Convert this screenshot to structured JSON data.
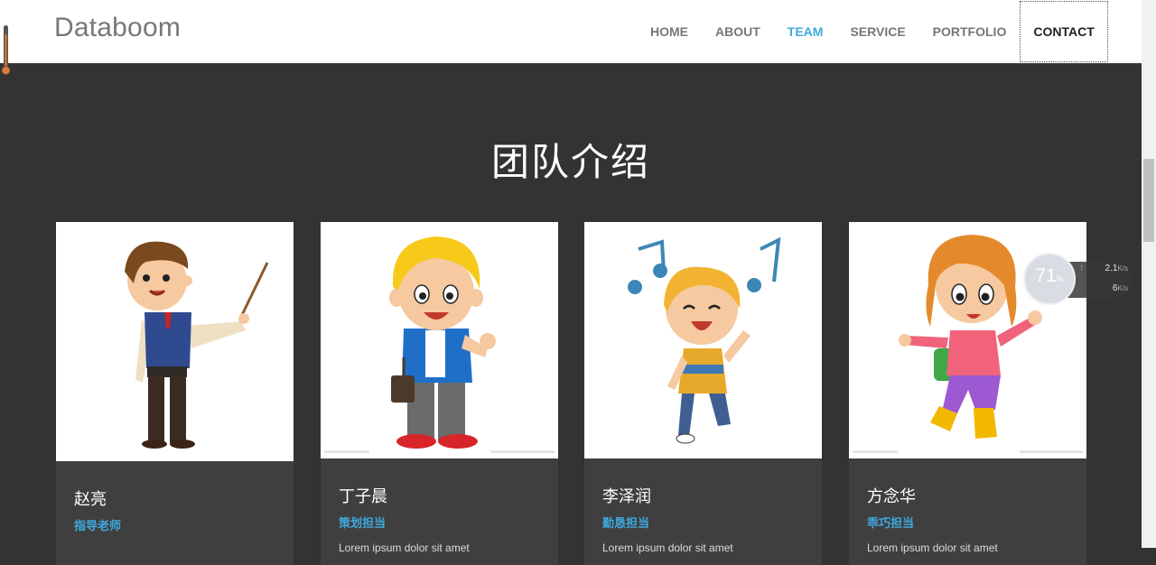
{
  "navbar": {
    "brand": "Databoom",
    "items": [
      {
        "label": "HOME",
        "state": "normal"
      },
      {
        "label": "ABOUT",
        "state": "normal"
      },
      {
        "label": "TEAM",
        "state": "active"
      },
      {
        "label": "SERVICE",
        "state": "normal"
      },
      {
        "label": "PORTFOLIO",
        "state": "normal"
      },
      {
        "label": "CONTACT",
        "state": "focused"
      }
    ]
  },
  "section": {
    "title": "团队介绍"
  },
  "team": [
    {
      "name": "赵亮",
      "role": "指导老师",
      "description": "",
      "avatar": "teacher-illustration"
    },
    {
      "name": "丁子晨",
      "role": "策划担当",
      "description": "Lorem ipsum dolor sit amet",
      "avatar": "boy-thumbs-up-illustration"
    },
    {
      "name": "李泽润",
      "role": "勤恳担当",
      "description": "Lorem ipsum dolor sit amet",
      "avatar": "boy-dancing-illustration"
    },
    {
      "name": "方念华",
      "role": "乖巧担当",
      "description": "Lorem ipsum dolor sit amet",
      "avatar": "girl-backpack-illustration"
    }
  ],
  "speed_widget": {
    "percent": "71",
    "percent_unit": "%",
    "upload": "2.1",
    "upload_unit": "K/s",
    "download": "6",
    "download_unit": "K/s"
  },
  "colors": {
    "accent": "#3fa9e0",
    "background": "#333333",
    "card": "#3f3f3f"
  }
}
